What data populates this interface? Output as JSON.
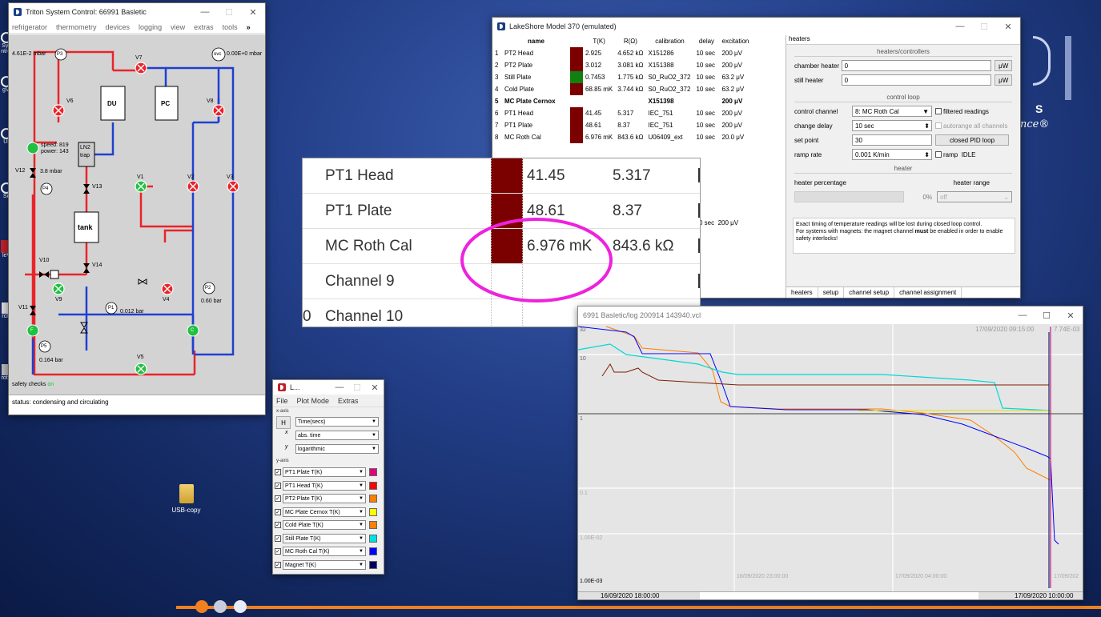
{
  "desktop": {
    "left_edge_labels": [
      "Sys\nntrol",
      "gVi",
      "Ur",
      "Sc",
      "leV",
      "rcle",
      "rotS"
    ],
    "folder_label": "USB-copy"
  },
  "triton": {
    "title": "Triton System Control: 66991 Basletic",
    "menu": [
      "refrigerator",
      "thermometry",
      "devices",
      "logging",
      "view",
      "extras",
      "tools",
      "»"
    ],
    "labels": {
      "p3_reading": "4.61E-2 mbar",
      "ovc_reading": "0.00E+0 mbar",
      "speed": "speed: 819",
      "power": "power: 143",
      "v12_reading": "3.8 mbar",
      "p1_reading": "0.012 bar",
      "p2_reading": "0.60 bar",
      "p5_reading": "0.164 bar",
      "du": "DU",
      "pc": "PC",
      "ln2": "LN2",
      "trap": "trap",
      "tank": "tank",
      "safety_label": "safety checks",
      "safety_state": "on"
    },
    "valves": [
      "V7",
      "V6",
      "V8",
      "V1",
      "V2",
      "V3",
      "V13",
      "V14",
      "V9",
      "V4",
      "V10",
      "V11",
      "V5",
      "V12"
    ],
    "gauges": [
      "P3",
      "ovc",
      "P4",
      "P1",
      "P2",
      "P5"
    ],
    "pumps": [
      "F",
      "C"
    ],
    "status": "status: condensing and circulating"
  },
  "lakeshore": {
    "title": "LakeShore Model 370 (emulated)",
    "columns": [
      "",
      "name",
      "T(K)",
      "R(Ω)",
      "calibration",
      "delay",
      "excitation"
    ],
    "rows": [
      {
        "n": "1",
        "name": "PT2 Head",
        "color": "#7b0000",
        "t": "2.925",
        "r": "4.652 kΩ",
        "cal": "X151286",
        "delay": "10 sec",
        "exc": "200 μV"
      },
      {
        "n": "2",
        "name": "PT2 Plate",
        "color": "#7b0000",
        "t": "3.012",
        "r": "3.081 kΩ",
        "cal": "X151388",
        "delay": "10 sec",
        "exc": "200 μV"
      },
      {
        "n": "3",
        "name": "Still Plate",
        "color": "#108010",
        "t": "0.7453",
        "r": "1.775 kΩ",
        "cal": "S0_RuO2_372",
        "delay": "10 sec",
        "exc": "63.2 μV"
      },
      {
        "n": "4",
        "name": "Cold Plate",
        "color": "#7b0000",
        "t": "68.85 mK",
        "r": "3.744 kΩ",
        "cal": "S0_RuO2_372",
        "delay": "10 sec",
        "exc": "63.2 μV"
      },
      {
        "n": "5",
        "name": "MC Plate Cernox",
        "color": "",
        "t": "",
        "r": "",
        "cal": "X151398",
        "delay": "",
        "exc": "200 μV"
      },
      {
        "n": "6",
        "name": "PT1 Head",
        "color": "#7b0000",
        "t": "41.45",
        "r": "5.317",
        "cal": "IEC_751",
        "delay": "10 sec",
        "exc": "200 μV"
      },
      {
        "n": "7",
        "name": "PT1 Plate",
        "color": "#7b0000",
        "t": "48.61",
        "r": "8.37",
        "cal": "IEC_751",
        "delay": "10 sec",
        "exc": "200 μV"
      },
      {
        "n": "8",
        "name": "MC Roth Cal",
        "color": "#7b0000",
        "t": "6.976 mK",
        "r": "843.6 kΩ",
        "cal": "U06409_ext",
        "delay": "10 sec",
        "exc": "20.0 μV"
      }
    ],
    "extra_delay": "0 sec",
    "extra_exc": "200 μV",
    "heaters": {
      "tab_label": "heaters",
      "section_hc": "heaters/controllers",
      "chamber_label": "chamber heater",
      "chamber_value": "0",
      "still_label": "still heater",
      "still_value": "0",
      "unit": "μW",
      "section_cl": "control loop",
      "control_channel_label": "control channel",
      "control_channel_value": "8: MC Roth Cal",
      "filtered_label": "filtered readings",
      "change_delay_label": "change delay",
      "change_delay_value": "10 sec",
      "autorange_label": "autorange all channels",
      "set_point_label": "set point",
      "set_point_value": "30",
      "pid_button": "closed PID loop",
      "ramp_rate_label": "ramp rate",
      "ramp_rate_value": "0.001 K/min",
      "ramp_label": "ramp",
      "ramp_state": "IDLE",
      "section_heater": "heater",
      "percentage_label": "heater percentage",
      "percentage_value": "0%",
      "range_label": "heater range",
      "range_value": "off",
      "note_1": "Exact timing of temperature readings will be lost during closed loop control.",
      "note_2": "For systems with magnets: the magnet channel ",
      "note_bold": "must",
      "note_3": " be enabled in order to enable safety interlocks!"
    },
    "tabs": [
      "heaters",
      "setup",
      "channel setup",
      "channel assignment"
    ]
  },
  "zoom": {
    "rows": [
      {
        "name": "PT1 Head",
        "t": "41.45",
        "r": "5.317",
        "swatch": true
      },
      {
        "name": "PT1 Plate",
        "t": "48.61",
        "r": "8.37",
        "swatch": true
      },
      {
        "name": "MC Roth Cal",
        "t": "6.976 mK",
        "r": "843.6 kΩ",
        "swatch": true
      },
      {
        "name": "Channel 9",
        "t": "",
        "r": "",
        "swatch": false
      },
      {
        "name": "Channel 10",
        "t": "",
        "r": "",
        "swatch": false,
        "prefix": "0"
      }
    ]
  },
  "plotmode": {
    "title": "L...",
    "menu": [
      "File",
      "Plot Mode",
      "Extras"
    ],
    "xaxis_label": "x-axis",
    "x_h": "H",
    "x_x": "x",
    "x_y": "y",
    "x_options": [
      "Time(secs)",
      "abs. time",
      "logarithmic"
    ],
    "yaxis_label": "y-axis",
    "series": [
      {
        "name": "PT1 Plate T(K)",
        "color": "#e0007a"
      },
      {
        "name": "PT1 Head T(K)",
        "color": "#ff0000"
      },
      {
        "name": "PT2 Plate T(K)",
        "color": "#ff7f00"
      },
      {
        "name": "MC Plate Cernox T(K)",
        "color": "#ffff00"
      },
      {
        "name": "Cold Plate T(K)",
        "color": "#ff7f00"
      },
      {
        "name": "Still Plate T(K)",
        "color": "#00e0e0"
      },
      {
        "name": "MC Roth Cal T(K)",
        "color": "#0000ff"
      },
      {
        "name": "Magnet T(K)",
        "color": "#000060"
      }
    ]
  },
  "logplot": {
    "title": "6991 Basletic/log 200914 143940.vcl",
    "top_timestamp": "17/09/2020 09:15:00",
    "top_value": "7.74E-03",
    "y_labels": [
      "32",
      "10",
      "1",
      "0.1",
      "1.00E-02",
      "1.00E-03"
    ],
    "x_labels": [
      "16/09/2020 23:00:00",
      "17/09/2020 04:00:00",
      "17/09/202"
    ],
    "bottom_left": "16/09/2020 18:00:00",
    "bottom_right": "17/09/2020 10:00:00"
  },
  "colors": {
    "hot_line": "#e8242a",
    "cold_line": "#2040d0",
    "valve_open": "#20c040",
    "valve_closed": "#e8242a",
    "accent": "#f08020"
  }
}
